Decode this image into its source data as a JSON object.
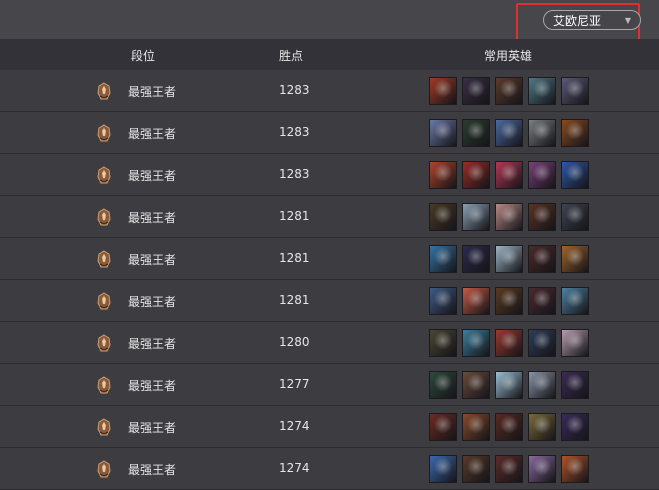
{
  "server": {
    "selected": "艾欧尼亚"
  },
  "columns": {
    "rank": "段位",
    "points": "胜点",
    "champions": "常用英雄"
  },
  "rows": [
    {
      "rank": "最强王者",
      "points": "1283",
      "champions": [
        "#a03a24",
        "#3a2f46",
        "#5d3b2a",
        "#4d7a87",
        "#5b5a79"
      ]
    },
    {
      "rank": "最强王者",
      "points": "1283",
      "champions": [
        "#6a79a8",
        "#2b3d2f",
        "#4a6aa0",
        "#7a7f82",
        "#8a4a1e"
      ]
    },
    {
      "rank": "最强王者",
      "points": "1283",
      "champions": [
        "#b0442a",
        "#9a2d23",
        "#b53855",
        "#7b3f7a",
        "#2d58a8"
      ]
    },
    {
      "rank": "最强王者",
      "points": "1281",
      "champions": [
        "#4a3a25",
        "#8aa1b5",
        "#b98a86",
        "#5b3224",
        "#3e4552"
      ]
    },
    {
      "rank": "最强王者",
      "points": "1281",
      "champions": [
        "#3575a6",
        "#2b2b4e",
        "#9db6c8",
        "#4d2a2a",
        "#a0642a"
      ]
    },
    {
      "rank": "最强王者",
      "points": "1281",
      "champions": [
        "#3f5b86",
        "#c45a44",
        "#5b3a22",
        "#4a2a30",
        "#4d82a0"
      ]
    },
    {
      "rank": "最强王者",
      "points": "1280",
      "champions": [
        "#4a4632",
        "#3a7fa0",
        "#9a3a2c",
        "#2c3e5a",
        "#b79db0"
      ]
    },
    {
      "rank": "最强王者",
      "points": "1277",
      "champions": [
        "#2d4a3c",
        "#6b4a3a",
        "#9ac0d6",
        "#8a94a6",
        "#3a2c52"
      ]
    },
    {
      "rank": "最强王者",
      "points": "1274",
      "champions": [
        "#6a2c22",
        "#8a4a2a",
        "#5a2a20",
        "#7a6a3a",
        "#3a2a5a"
      ]
    },
    {
      "rank": "最强王者",
      "points": "1274",
      "champions": [
        "#3a6ab0",
        "#5a3a2a",
        "#5c2c28",
        "#8a6aa0",
        "#b0542a"
      ]
    }
  ]
}
